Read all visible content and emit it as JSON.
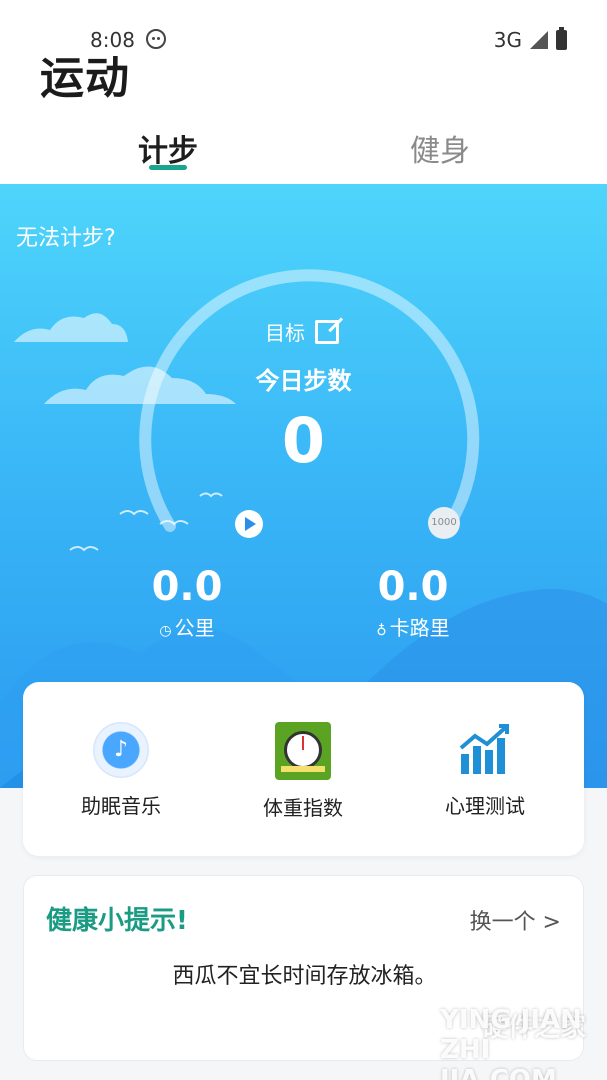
{
  "status_bar": {
    "time": "8:08",
    "network": "3G",
    "face_icon": "face-icon",
    "signal_icon": "signal-icon",
    "battery_icon": "battery-icon"
  },
  "header": {
    "title": "运动",
    "tabs": [
      {
        "label": "计步",
        "active": true
      },
      {
        "label": "健身",
        "active": false
      }
    ],
    "accent_color": "#1aa58f"
  },
  "hero": {
    "cant_count_link": "无法计步?",
    "goal_label": "目标",
    "goal_icon": "edit-icon",
    "today_label": "今日步数",
    "steps": "0",
    "goal_value": "1000",
    "play_icon": "play-icon",
    "distance": {
      "value": "0.0",
      "label": "公里",
      "icon": "clock-icon"
    },
    "calories": {
      "value": "0.0",
      "label": "卡路里",
      "icon": "flame-icon"
    },
    "gradient_top": "#4ed5fb",
    "gradient_bottom": "#2a9bf0"
  },
  "tools": [
    {
      "label": "助眠音乐",
      "icon": "music-note-icon"
    },
    {
      "label": "体重指数",
      "icon": "scale-gauge-icon"
    },
    {
      "label": "心理测试",
      "icon": "bar-chart-icon"
    }
  ],
  "tip": {
    "title": "健康小提示!",
    "refresh_label": "换一个 >",
    "text": "西瓜不宜长时间存放冰箱。",
    "title_color": "#1a9b84"
  },
  "watermark": {
    "text": "硬件之家",
    "sub": "YING JIAN ZHI JIA.COM"
  }
}
